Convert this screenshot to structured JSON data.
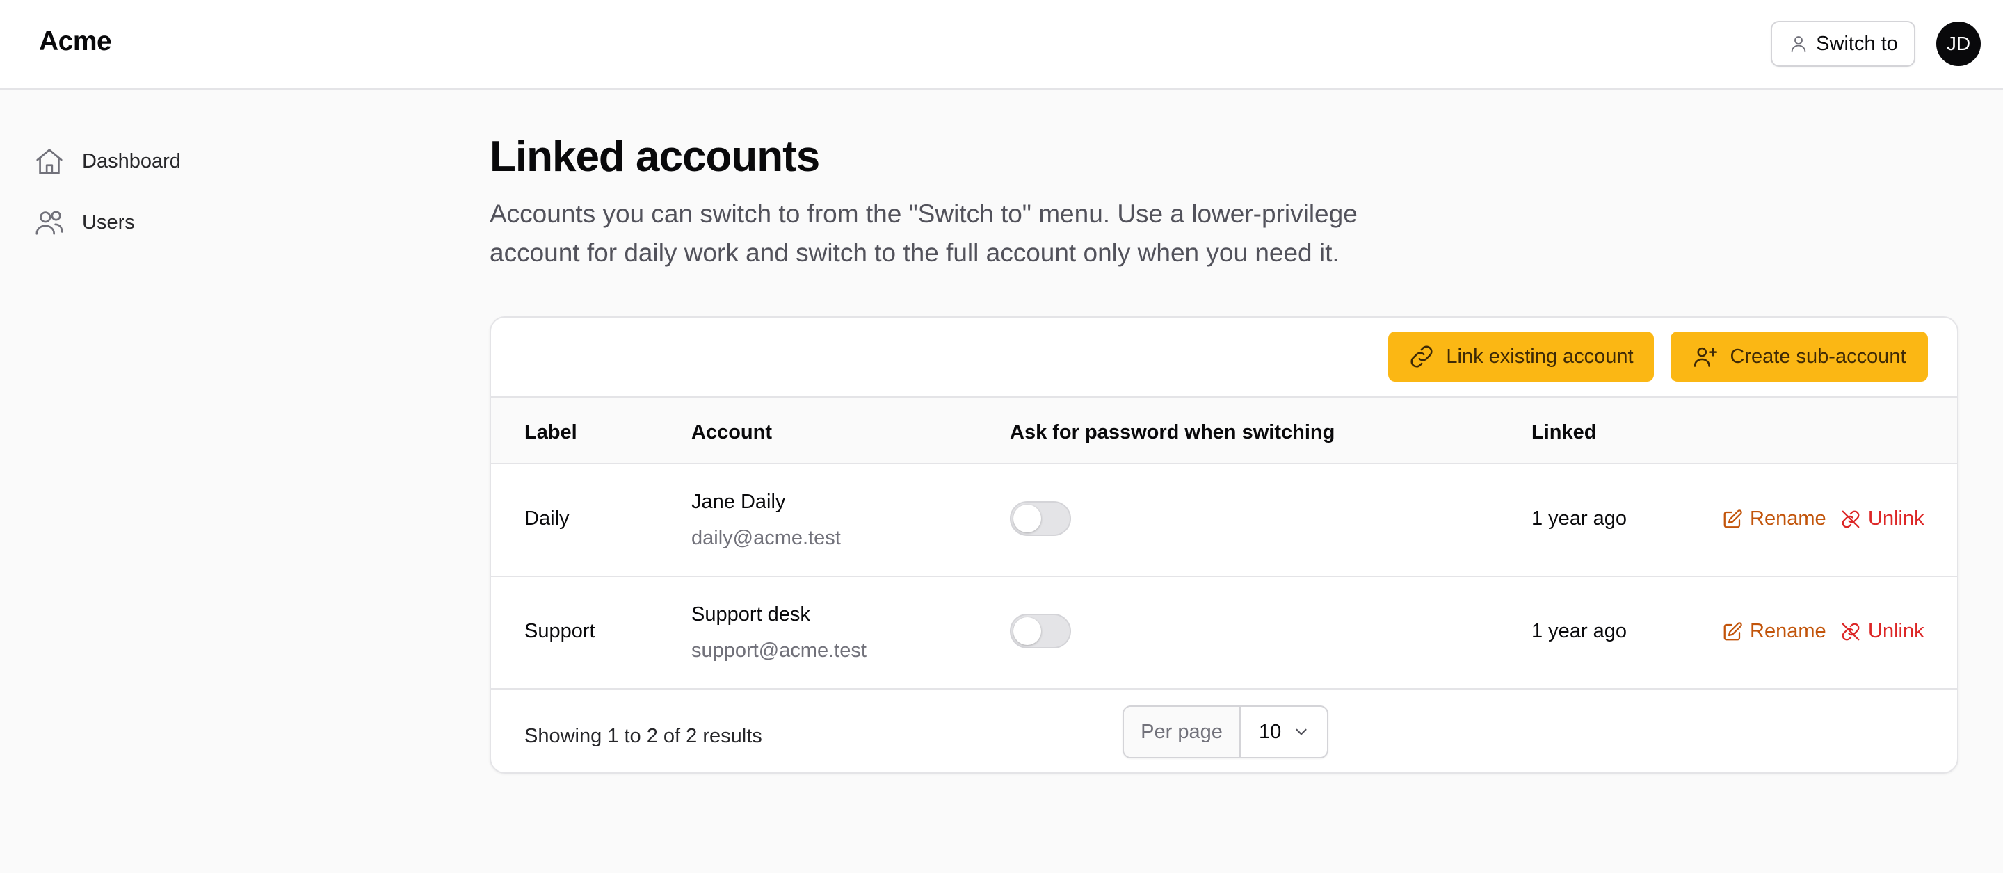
{
  "header": {
    "brand": "Acme",
    "switch_label": "Switch to",
    "avatar_initials": "JD"
  },
  "sidebar": {
    "items": [
      {
        "label": "Dashboard",
        "icon": "home-icon"
      },
      {
        "label": "Users",
        "icon": "users-icon"
      }
    ]
  },
  "main": {
    "title": "Linked accounts",
    "description": "Accounts you can switch to from the \"Switch to\" menu. Use a lower-privilege account for daily work and switch to the full account only when you need it."
  },
  "toolbar": {
    "link_label": "Link existing account",
    "create_label": "Create sub-account"
  },
  "table": {
    "columns": [
      "Label",
      "Account",
      "Ask for password when switching",
      "Linked"
    ],
    "rows": [
      {
        "label": "Daily",
        "account_name": "Jane Daily",
        "account_email": "daily@acme.test",
        "ask_password": false,
        "linked": "1 year ago",
        "rename": "Rename",
        "unlink": "Unlink"
      },
      {
        "label": "Support",
        "account_name": "Support desk",
        "account_email": "support@acme.test",
        "ask_password": false,
        "linked": "1 year ago",
        "rename": "Rename",
        "unlink": "Unlink"
      }
    ]
  },
  "pagination": {
    "summary": "Showing 1 to 2 of 2 results",
    "per_page_label": "Per page",
    "per_page_value": "10"
  },
  "colors": {
    "accent": "#fbb714",
    "rename": "#c2540a",
    "unlink": "#dc2626"
  }
}
